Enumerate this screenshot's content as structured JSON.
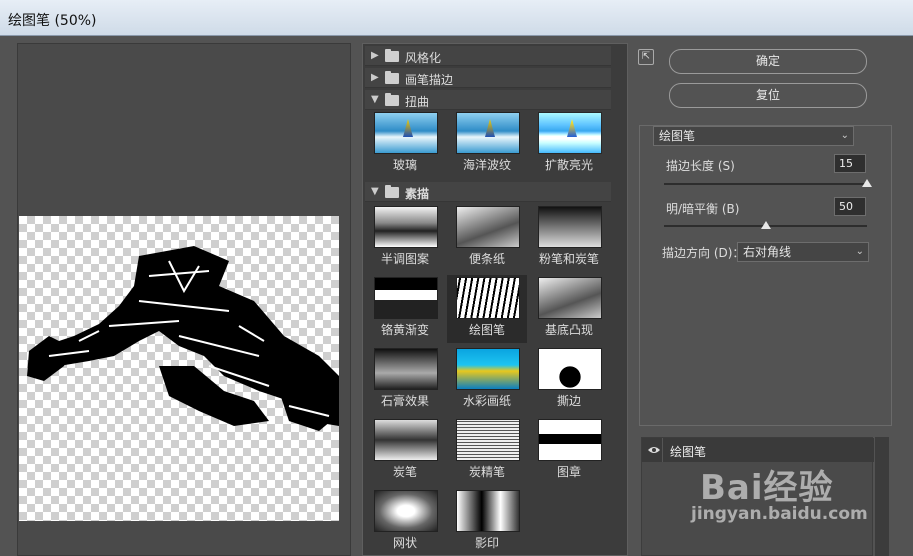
{
  "window": {
    "title": "绘图笔 (50%)"
  },
  "gallery": {
    "categories": [
      {
        "label": "风格化",
        "expanded": false
      },
      {
        "label": "画笔描边",
        "expanded": false
      },
      {
        "label": "扭曲",
        "expanded": true
      },
      {
        "label": "素描",
        "expanded": true
      }
    ],
    "distort_filters": [
      "玻璃",
      "海洋波纹",
      "扩散亮光"
    ],
    "sketch_filters": [
      "半调图案",
      "便条纸",
      "粉笔和炭笔",
      "铬黄渐变",
      "绘图笔",
      "基底凸现",
      "石膏效果",
      "水彩画纸",
      "撕边",
      "炭笔",
      "炭精笔",
      "图章",
      "网状",
      "影印"
    ],
    "selected": "绘图笔"
  },
  "buttons": {
    "ok": "确定",
    "reset": "复位"
  },
  "settings": {
    "filter_select": "绘图笔",
    "stroke_length_label": "描边长度 (S)",
    "stroke_length_value": "15",
    "stroke_length_fraction": 1.0,
    "balance_label": "明/暗平衡 (B)",
    "balance_value": "50",
    "balance_fraction": 0.5,
    "direction_label": "描边方向 (D)：",
    "direction_value": "右对角线"
  },
  "layers": {
    "items": [
      {
        "name": "绘图笔",
        "visible": true
      }
    ]
  },
  "watermark": {
    "brand": "Bai经验",
    "url": "jingyan.baidu.com"
  }
}
